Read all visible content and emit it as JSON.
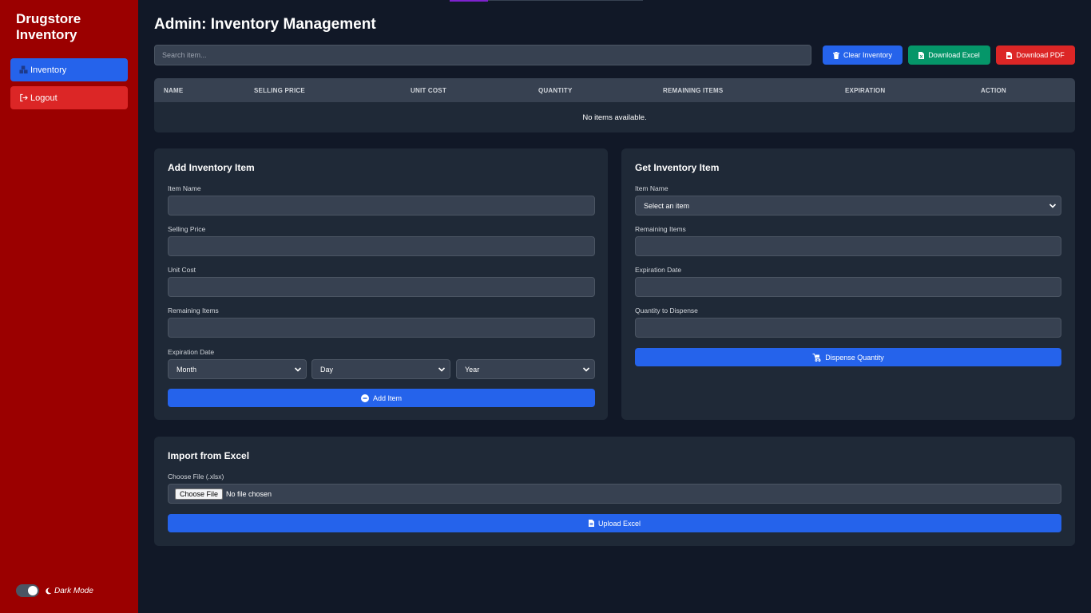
{
  "sidebar": {
    "brand": "Drugstore Inventory",
    "nav": [
      {
        "label": "Inventory",
        "icon": "boxes-icon"
      },
      {
        "label": "Logout",
        "icon": "logout-icon"
      }
    ],
    "dark_mode_label": "Dark Mode"
  },
  "header": {
    "title": "Admin: Inventory Management"
  },
  "toolbar": {
    "search_placeholder": "Search item...",
    "clear_label": "Clear Inventory",
    "excel_label": "Download Excel",
    "pdf_label": "Download PDF"
  },
  "table": {
    "columns": [
      "NAME",
      "SELLING PRICE",
      "UNIT COST",
      "QUANTITY",
      "REMAINING ITEMS",
      "EXPIRATION",
      "ACTION"
    ],
    "empty_text": "No items available."
  },
  "add_form": {
    "title": "Add Inventory Item",
    "item_name_label": "Item Name",
    "selling_price_label": "Selling Price",
    "unit_cost_label": "Unit Cost",
    "remaining_items_label": "Remaining Items",
    "expiration_label": "Expiration Date",
    "month": "Month",
    "day": "Day",
    "year": "Year",
    "submit_label": "Add Item"
  },
  "get_form": {
    "title": "Get Inventory Item",
    "item_name_label": "Item Name",
    "select_value": "Select an item",
    "remaining_items_label": "Remaining Items",
    "expiration_label": "Expiration Date",
    "quantity_label": "Quantity to Dispense",
    "submit_label": "Dispense Quantity"
  },
  "import": {
    "title": "Import from Excel",
    "file_label": "Choose File (.xlsx)",
    "choose_button": "Choose File",
    "no_file": "No file chosen",
    "upload_label": "Upload Excel"
  },
  "colors": {
    "sidebar": "#9b0000",
    "primary": "#2563eb",
    "success": "#059669",
    "danger": "#dc2626",
    "background": "#111827",
    "card": "#1f2937"
  }
}
